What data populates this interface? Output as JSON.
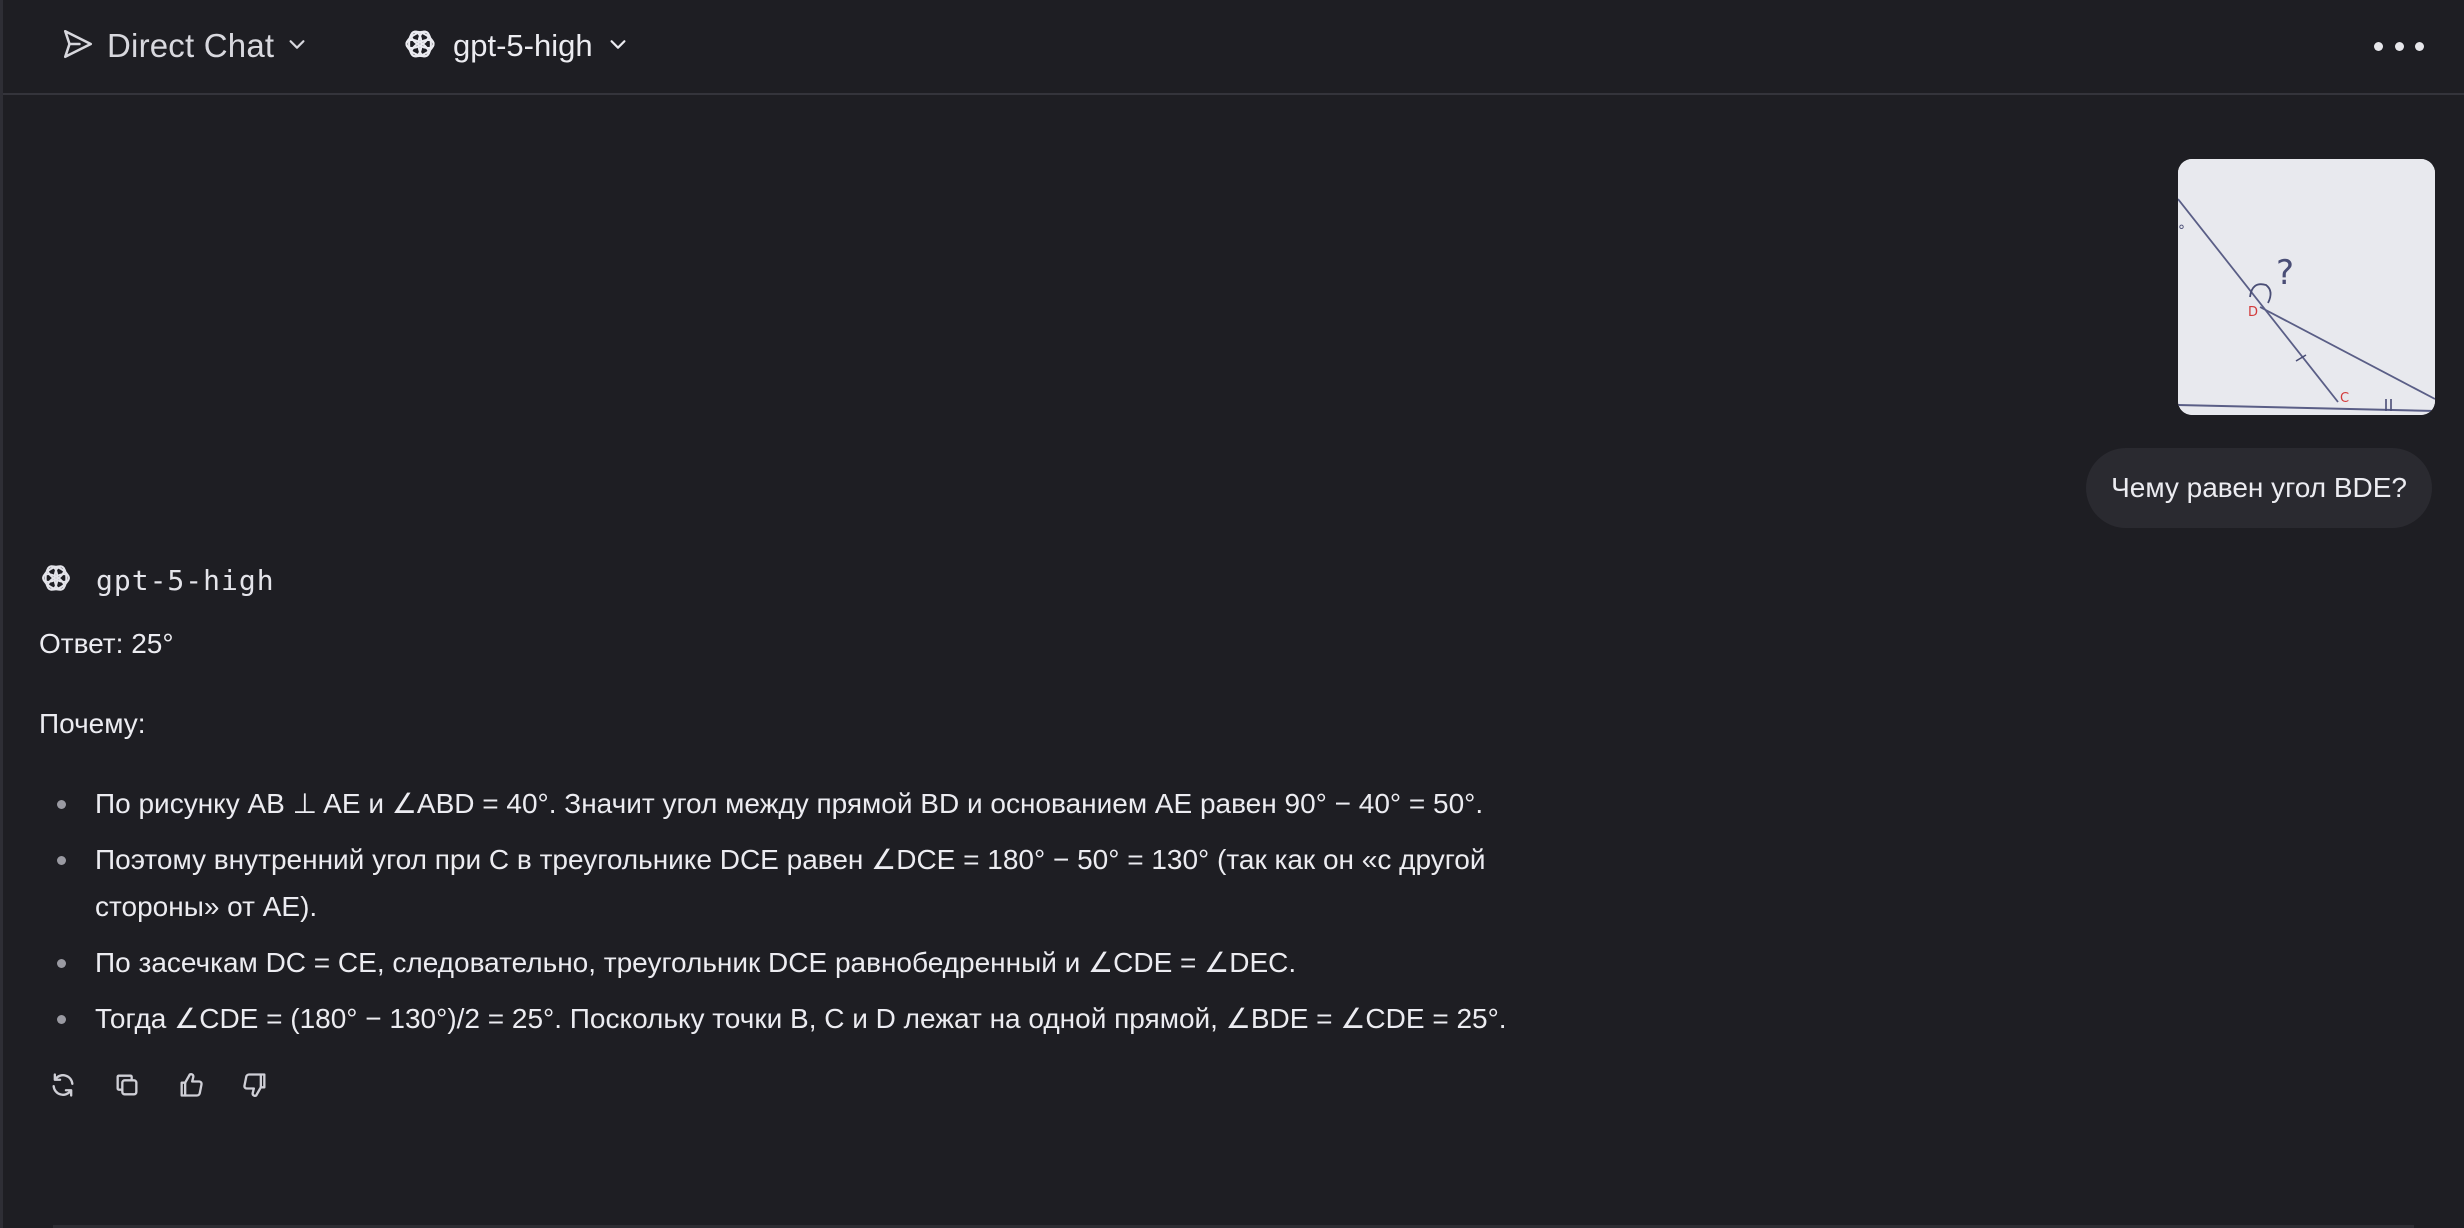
{
  "header": {
    "mode_label": "Direct Chat",
    "model_label": "gpt-5-high"
  },
  "conversation": {
    "user": {
      "image_alt": "Фото чертежа с треугольником",
      "message": "Чему равен угол BDE?"
    },
    "assistant": {
      "model_name": "gpt-5-high",
      "answer_line": "Ответ: 25°",
      "why_label": "Почему:",
      "bullets": [
        "По рисунку AB ⊥ AE и ∠ABD = 40°. Значит угол между прямой BD и основанием AE равен 90° − 40° = 50°.",
        "Поэтому внутренний угол при C в треугольнике DCE равен ∠DCE = 180° − 50° = 130° (так как он «с другой стороны» от AE).",
        "По засечкам DC = CE, следовательно, треугольник DCE равнобедренный и ∠CDE = ∠DEC.",
        "Тогда ∠CDE = (180° − 130°)/2 = 25°. Поскольку точки B, C и D лежат на одной прямой, ∠BDE = ∠CDE = 25°."
      ]
    }
  },
  "icons": {
    "mode": "send-icon",
    "model": "openai-logo-icon",
    "actions": [
      "regenerate-icon",
      "copy-icon",
      "thumbs-up-icon",
      "thumbs-down-icon"
    ]
  }
}
